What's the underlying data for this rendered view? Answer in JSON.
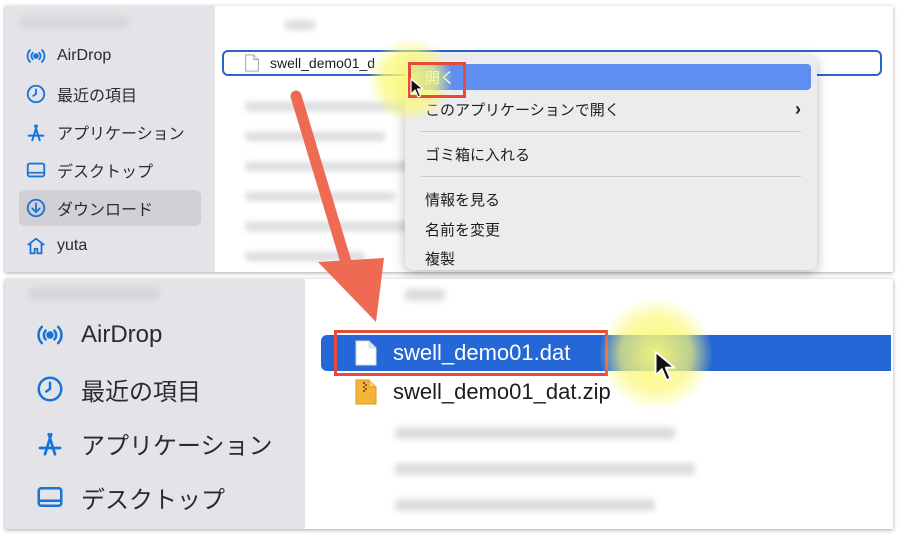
{
  "top_panel": {
    "sidebar": [
      {
        "label": "AirDrop",
        "icon": "airdrop-icon"
      },
      {
        "label": "最近の項目",
        "icon": "clock-icon"
      },
      {
        "label": "アプリケーション",
        "icon": "applications-icon"
      },
      {
        "label": "デスクトップ",
        "icon": "desktop-icon"
      },
      {
        "label": "ダウンロード",
        "icon": "download-icon",
        "selected": true
      },
      {
        "label": "yuta",
        "icon": "home-icon"
      }
    ],
    "file_row": {
      "name": "swell_demo01_d",
      "icon": "document-icon"
    },
    "context_menu": {
      "items": [
        {
          "label": "開く",
          "highlighted": true
        },
        {
          "label": "このアプリケーションで開く",
          "submenu": true
        },
        {
          "label": "ゴミ箱に入れる"
        },
        {
          "label": "情報を見る"
        },
        {
          "label": "名前を変更"
        },
        {
          "label": "複製"
        }
      ],
      "submenu_glyph": "›"
    }
  },
  "bottom_panel": {
    "sidebar": [
      {
        "label": "AirDrop",
        "icon": "airdrop-icon"
      },
      {
        "label": "最近の項目",
        "icon": "clock-icon"
      },
      {
        "label": "アプリケーション",
        "icon": "applications-icon"
      },
      {
        "label": "デスクトップ",
        "icon": "desktop-icon"
      }
    ],
    "files": [
      {
        "name": "swell_demo01.dat",
        "icon": "document-icon",
        "selected": true
      },
      {
        "name": "swell_demo01_dat.zip",
        "icon": "zip-archive-icon",
        "selected": false
      }
    ]
  },
  "colors": {
    "selection_blue": "#2567d6",
    "menu_highlight": "#5e8ef0",
    "annotation_red": "#e64a3b",
    "arrow": "#ee6a52",
    "cursor_highlight": "#f8f67a",
    "sidebar_icon": "#1a73d9",
    "zip_folder": "#f2b53a"
  }
}
